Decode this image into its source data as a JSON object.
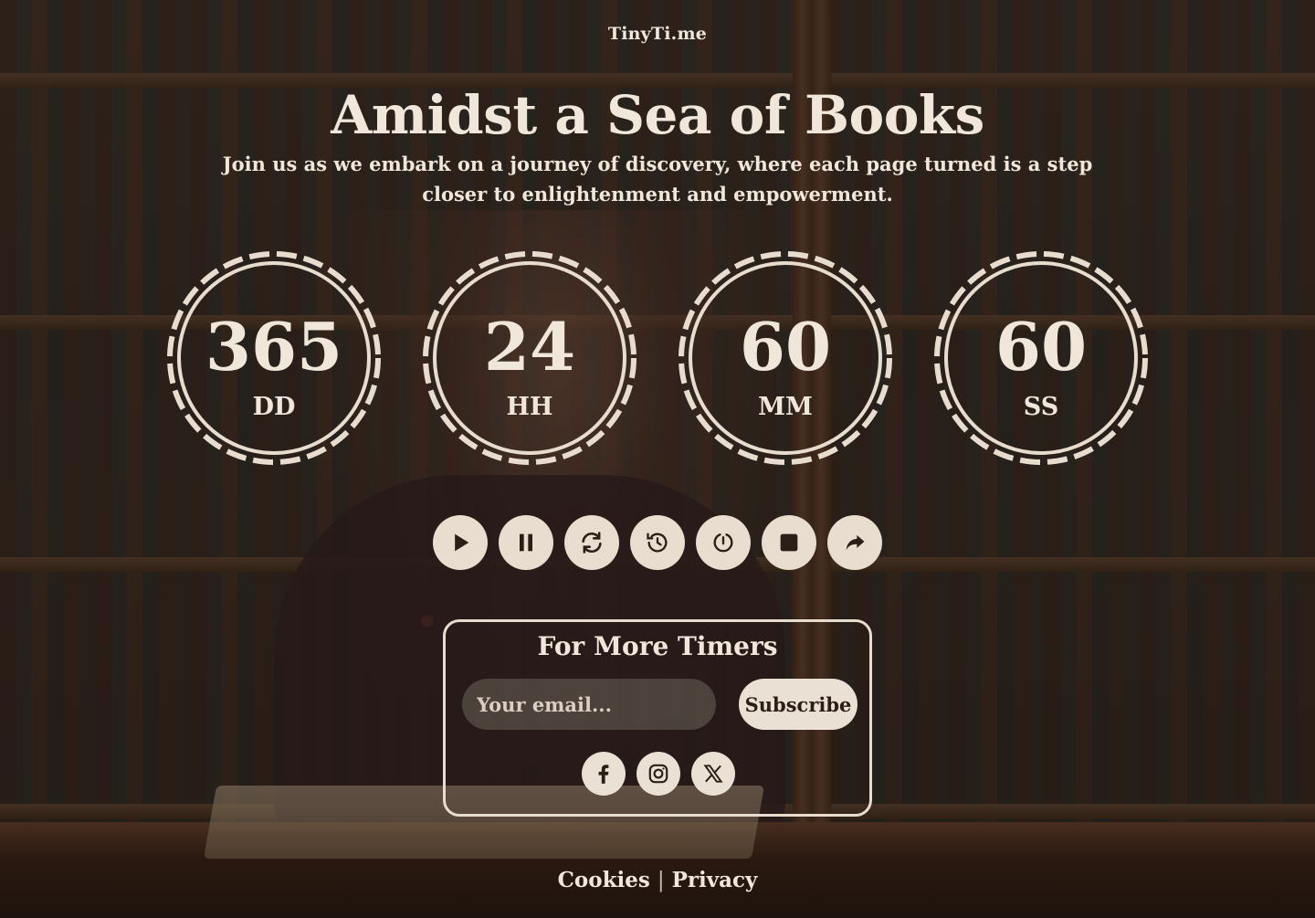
{
  "brand": "TinyTi.me",
  "hero": {
    "title": "Amidst a Sea of Books",
    "subtitle": "Join us as we embark on a journey of discovery, where each page turned is a step closer to enlightenment and empowerment."
  },
  "timers": [
    {
      "value": "365",
      "unit": "DD"
    },
    {
      "value": "24",
      "unit": "HH"
    },
    {
      "value": "60",
      "unit": "MM"
    },
    {
      "value": "60",
      "unit": "SS"
    }
  ],
  "controls": [
    "play-icon",
    "pause-icon",
    "refresh-icon",
    "history-icon",
    "restart-icon",
    "stop-icon",
    "share-icon"
  ],
  "subscribe": {
    "heading": "For More Timers",
    "email_placeholder": "Your email...",
    "email_value": "",
    "button_label": "Subscribe"
  },
  "socials": [
    "facebook-icon",
    "instagram-icon",
    "x-icon"
  ],
  "footer": {
    "cookies": "Cookies",
    "separator": "|",
    "privacy": "Privacy"
  },
  "colors": {
    "text": "#f0e6da",
    "button_bg": "#ebe0d4",
    "icon": "#2a1e17"
  }
}
